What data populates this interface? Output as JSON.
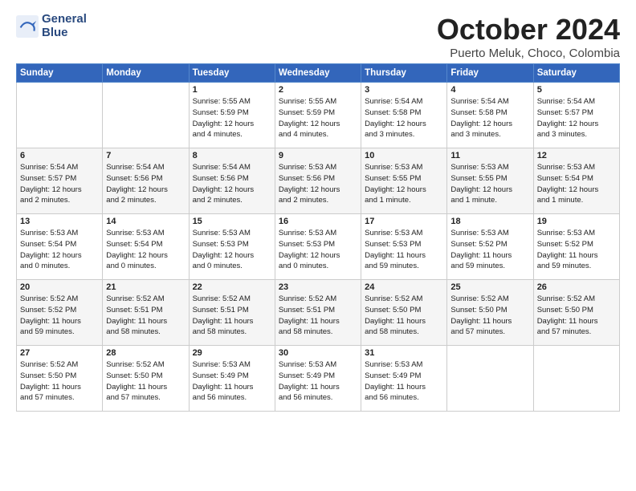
{
  "logo": {
    "line1": "General",
    "line2": "Blue"
  },
  "title": "October 2024",
  "location": "Puerto Meluk, Choco, Colombia",
  "days_header": [
    "Sunday",
    "Monday",
    "Tuesday",
    "Wednesday",
    "Thursday",
    "Friday",
    "Saturday"
  ],
  "weeks": [
    [
      {
        "num": "",
        "info": ""
      },
      {
        "num": "",
        "info": ""
      },
      {
        "num": "1",
        "info": "Sunrise: 5:55 AM\nSunset: 5:59 PM\nDaylight: 12 hours\nand 4 minutes."
      },
      {
        "num": "2",
        "info": "Sunrise: 5:55 AM\nSunset: 5:59 PM\nDaylight: 12 hours\nand 4 minutes."
      },
      {
        "num": "3",
        "info": "Sunrise: 5:54 AM\nSunset: 5:58 PM\nDaylight: 12 hours\nand 3 minutes."
      },
      {
        "num": "4",
        "info": "Sunrise: 5:54 AM\nSunset: 5:58 PM\nDaylight: 12 hours\nand 3 minutes."
      },
      {
        "num": "5",
        "info": "Sunrise: 5:54 AM\nSunset: 5:57 PM\nDaylight: 12 hours\nand 3 minutes."
      }
    ],
    [
      {
        "num": "6",
        "info": "Sunrise: 5:54 AM\nSunset: 5:57 PM\nDaylight: 12 hours\nand 2 minutes."
      },
      {
        "num": "7",
        "info": "Sunrise: 5:54 AM\nSunset: 5:56 PM\nDaylight: 12 hours\nand 2 minutes."
      },
      {
        "num": "8",
        "info": "Sunrise: 5:54 AM\nSunset: 5:56 PM\nDaylight: 12 hours\nand 2 minutes."
      },
      {
        "num": "9",
        "info": "Sunrise: 5:53 AM\nSunset: 5:56 PM\nDaylight: 12 hours\nand 2 minutes."
      },
      {
        "num": "10",
        "info": "Sunrise: 5:53 AM\nSunset: 5:55 PM\nDaylight: 12 hours\nand 1 minute."
      },
      {
        "num": "11",
        "info": "Sunrise: 5:53 AM\nSunset: 5:55 PM\nDaylight: 12 hours\nand 1 minute."
      },
      {
        "num": "12",
        "info": "Sunrise: 5:53 AM\nSunset: 5:54 PM\nDaylight: 12 hours\nand 1 minute."
      }
    ],
    [
      {
        "num": "13",
        "info": "Sunrise: 5:53 AM\nSunset: 5:54 PM\nDaylight: 12 hours\nand 0 minutes."
      },
      {
        "num": "14",
        "info": "Sunrise: 5:53 AM\nSunset: 5:54 PM\nDaylight: 12 hours\nand 0 minutes."
      },
      {
        "num": "15",
        "info": "Sunrise: 5:53 AM\nSunset: 5:53 PM\nDaylight: 12 hours\nand 0 minutes."
      },
      {
        "num": "16",
        "info": "Sunrise: 5:53 AM\nSunset: 5:53 PM\nDaylight: 12 hours\nand 0 minutes."
      },
      {
        "num": "17",
        "info": "Sunrise: 5:53 AM\nSunset: 5:53 PM\nDaylight: 11 hours\nand 59 minutes."
      },
      {
        "num": "18",
        "info": "Sunrise: 5:53 AM\nSunset: 5:52 PM\nDaylight: 11 hours\nand 59 minutes."
      },
      {
        "num": "19",
        "info": "Sunrise: 5:53 AM\nSunset: 5:52 PM\nDaylight: 11 hours\nand 59 minutes."
      }
    ],
    [
      {
        "num": "20",
        "info": "Sunrise: 5:52 AM\nSunset: 5:52 PM\nDaylight: 11 hours\nand 59 minutes."
      },
      {
        "num": "21",
        "info": "Sunrise: 5:52 AM\nSunset: 5:51 PM\nDaylight: 11 hours\nand 58 minutes."
      },
      {
        "num": "22",
        "info": "Sunrise: 5:52 AM\nSunset: 5:51 PM\nDaylight: 11 hours\nand 58 minutes."
      },
      {
        "num": "23",
        "info": "Sunrise: 5:52 AM\nSunset: 5:51 PM\nDaylight: 11 hours\nand 58 minutes."
      },
      {
        "num": "24",
        "info": "Sunrise: 5:52 AM\nSunset: 5:50 PM\nDaylight: 11 hours\nand 58 minutes."
      },
      {
        "num": "25",
        "info": "Sunrise: 5:52 AM\nSunset: 5:50 PM\nDaylight: 11 hours\nand 57 minutes."
      },
      {
        "num": "26",
        "info": "Sunrise: 5:52 AM\nSunset: 5:50 PM\nDaylight: 11 hours\nand 57 minutes."
      }
    ],
    [
      {
        "num": "27",
        "info": "Sunrise: 5:52 AM\nSunset: 5:50 PM\nDaylight: 11 hours\nand 57 minutes."
      },
      {
        "num": "28",
        "info": "Sunrise: 5:52 AM\nSunset: 5:50 PM\nDaylight: 11 hours\nand 57 minutes."
      },
      {
        "num": "29",
        "info": "Sunrise: 5:53 AM\nSunset: 5:49 PM\nDaylight: 11 hours\nand 56 minutes."
      },
      {
        "num": "30",
        "info": "Sunrise: 5:53 AM\nSunset: 5:49 PM\nDaylight: 11 hours\nand 56 minutes."
      },
      {
        "num": "31",
        "info": "Sunrise: 5:53 AM\nSunset: 5:49 PM\nDaylight: 11 hours\nand 56 minutes."
      },
      {
        "num": "",
        "info": ""
      },
      {
        "num": "",
        "info": ""
      }
    ]
  ]
}
